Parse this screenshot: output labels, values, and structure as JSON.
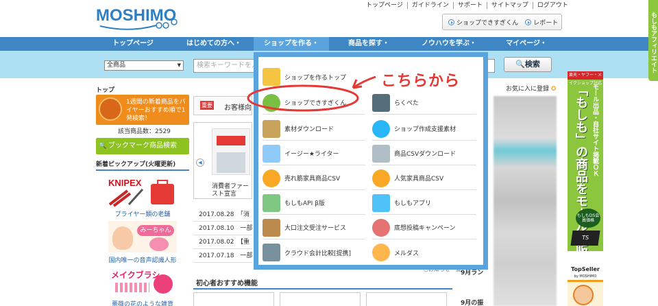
{
  "header": {
    "logo": "MOSHIMO",
    "top_links": [
      "トップページ",
      "ガイドライン",
      "サポート",
      "サイトマップ",
      "ログアウト"
    ],
    "buttons": [
      "ショップできすぎくん",
      "レポート"
    ]
  },
  "side_tab": "もしもアフィリエイト",
  "nav": {
    "items": [
      "トップページ",
      "はじめての方へ・",
      "ショップを作る・",
      "商品を探す・",
      "ノウハウを学ぶ・",
      "マイページ・"
    ]
  },
  "search": {
    "category": "全商品",
    "placeholder": "検索キーワードを入",
    "button": "検索"
  },
  "left": {
    "breadcrumb": "トップ",
    "promo_text": "1週間の新着商品をバイヤーおすすめ順で1発検索！",
    "count_label": "該当商品数：2529",
    "bookmark_button": "ブックマーク商品検索",
    "pickup_title": "新着ピックアップ(火曜更新)",
    "pickup_brand": "KNIPEX",
    "items": [
      "プライヤー類の老舗",
      "国内唯一の音声認識人形",
      "薔薇の花のような雑貨"
    ],
    "doll_label": "みーちゃん",
    "makeup_label": "メイクブラシ"
  },
  "center": {
    "important_badge": "重要",
    "important_text": "お客様向",
    "slide_text": "消費者ファースト宣言",
    "news": [
      {
        "date": "2017.08.28",
        "text": "「消"
      },
      {
        "date": "2017.08.10",
        "text": "一部"
      },
      {
        "date": "2017.08.02",
        "text": "【重"
      },
      {
        "date": "2017.07.18",
        "text": "一部"
      }
    ],
    "recommend_title": "初心者おすすめ機能",
    "news_more": "お知らせ一覧"
  },
  "right": {
    "favorite_link": "お気に入に登録",
    "labels": [
      "9月ラン",
      "9月の振"
    ]
  },
  "sidead": {
    "top": "楽天・ヤフー・メイクショップ対応",
    "line1": "モール出品・自社サイト掲載ＯＫ",
    "line2": "「もしも」の商品をモールで販売",
    "badge": "もしもDS会員価格",
    "brand": "TopSeller",
    "brand_sub": "by MOSHIMO"
  },
  "dropdown": {
    "items": [
      {
        "label": "ショップを作るトップ",
        "icon": "shop-icon"
      },
      {
        "label": "ショップできすぎくん",
        "icon": "mascot-icon"
      },
      {
        "label": "らくぺた",
        "icon": "page-icon"
      },
      {
        "label": "素材ダウンロード",
        "icon": "image-icon"
      },
      {
        "label": "ショップ作成支援素材",
        "icon": "snake-icon"
      },
      {
        "label": "イージー★ライター",
        "icon": "printer-icon"
      },
      {
        "label": "商品CSVダウンロード",
        "icon": "csv-icon"
      },
      {
        "label": "売れ筋家具商品CSV",
        "icon": "medal-icon"
      },
      {
        "label": "人気家具商品CSV",
        "icon": "medal-icon"
      },
      {
        "label": "もしもAPI β版",
        "icon": "api-icon"
      },
      {
        "label": "もしもアプリ",
        "icon": "cube-icon"
      },
      {
        "label": "大口注文受注サービス",
        "icon": "box-icon"
      },
      {
        "label": "底想投稿キャンペーン",
        "icon": "pen-icon"
      },
      {
        "label": "クラウド会計比較[提携]",
        "icon": "calculator-icon"
      },
      {
        "label": "メルダス",
        "icon": "mail-person-icon"
      }
    ]
  },
  "annotation": {
    "callout": "こちらから",
    "color": "#e53935"
  }
}
